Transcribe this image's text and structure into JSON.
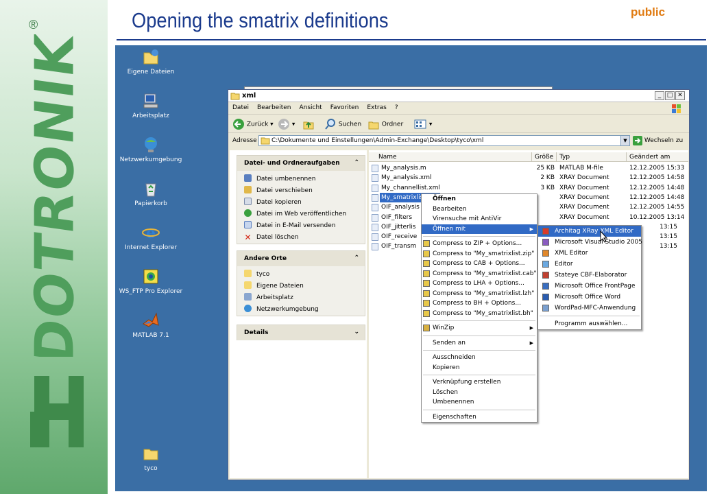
{
  "slide": {
    "title": "Opening the smatrix definitions",
    "classification": "public",
    "brand": "EDOTRONIK",
    "brand_reg": "®"
  },
  "desktop": {
    "icons": [
      {
        "label": "Eigene Dateien",
        "icon": "my-documents-icon"
      },
      {
        "label": "Arbeitsplatz",
        "icon": "my-computer-icon"
      },
      {
        "label": "Netzwerkumgebung",
        "icon": "network-icon"
      },
      {
        "label": "Papierkorb",
        "icon": "recycle-bin-icon"
      },
      {
        "label": "Internet Explorer",
        "icon": "internet-explorer-icon"
      },
      {
        "label": "WS_FTP Pro Explorer",
        "icon": "ftp-icon"
      },
      {
        "label": "MATLAB 7.1",
        "icon": "matlab-icon"
      },
      {
        "label": "tyco",
        "icon": "folder-icon"
      }
    ]
  },
  "window": {
    "title": "xml",
    "menu": [
      "Datei",
      "Bearbeiten",
      "Ansicht",
      "Favoriten",
      "Extras",
      "?"
    ],
    "toolbar": {
      "back": "Zurück",
      "search": "Suchen",
      "folders": "Ordner"
    },
    "address_label": "Adresse",
    "address": "C:\\Dokumente und Einstellungen\\Admin-Exchange\\Desktop\\tyco\\xml",
    "go_label": "Wechseln zu"
  },
  "taskpane": {
    "file_tasks": {
      "title": "Datei- und Ordneraufgaben",
      "items": [
        "Datei umbenennen",
        "Datei verschieben",
        "Datei kopieren",
        "Datei im Web veröffentlichen",
        "Datei in E-Mail versenden",
        "Datei löschen"
      ]
    },
    "other_places": {
      "title": "Andere Orte",
      "items": [
        "tyco",
        "Eigene Dateien",
        "Arbeitsplatz",
        "Netzwerkumgebung"
      ]
    },
    "details": {
      "title": "Details"
    }
  },
  "filelist": {
    "columns": [
      "Name",
      "Größe",
      "Typ",
      "Geändert am"
    ],
    "rows": [
      {
        "name": "My_analysis.m",
        "size": "25 KB",
        "type": "MATLAB M-file",
        "date": "12.12.2005 15:33"
      },
      {
        "name": "My_analysis.xml",
        "size": "2 KB",
        "type": "XRAY Document",
        "date": "12.12.2005 14:58"
      },
      {
        "name": "My_channellist.xml",
        "size": "3 KB",
        "type": "XRAY Document",
        "date": "12.12.2005 14:48"
      },
      {
        "name": "My_smatrixlist.xml",
        "size": "",
        "type": "XRAY Document",
        "date": "12.12.2005 14:48"
      },
      {
        "name": "OIF_analysis",
        "size": "",
        "type": "XRAY Document",
        "date": "12.12.2005 14:55"
      },
      {
        "name": "OIF_filters",
        "size": "",
        "type": "XRAY Document",
        "date": "10.12.2005 13:14"
      },
      {
        "name": "OIF_jitterlis",
        "size": "",
        "type": "",
        "date": "13:15"
      },
      {
        "name": "OIF_receive",
        "size": "",
        "type": "",
        "date": "13:15"
      },
      {
        "name": "OIF_transm",
        "size": "",
        "type": "",
        "date": "13:15"
      }
    ]
  },
  "context_menu": {
    "items": [
      {
        "label": "Öffnen",
        "bold": true
      },
      {
        "label": "Bearbeiten"
      },
      {
        "label": "Virensuche mit AntiVir"
      },
      {
        "label": "Öffnen mit",
        "submenu": true,
        "highlight": true
      },
      {
        "sep": true
      },
      {
        "label": "Compress to ZIP + Options...",
        "icon": "compress-icon"
      },
      {
        "label": "Compress to \"My_smatrixlist.zip\"",
        "icon": "compress-icon"
      },
      {
        "label": "Compress to CAB + Options...",
        "icon": "compress-icon"
      },
      {
        "label": "Compress to \"My_smatrixlist.cab\"",
        "icon": "compress-icon"
      },
      {
        "label": "Compress to LHA + Options...",
        "icon": "compress-icon"
      },
      {
        "label": "Compress to \"My_smatrixlist.lzh\"",
        "icon": "compress-icon"
      },
      {
        "label": "Compress to BH + Options...",
        "icon": "compress-icon"
      },
      {
        "label": "Compress to \"My_smatrixlist.bh\"",
        "icon": "compress-icon"
      },
      {
        "sep": true
      },
      {
        "label": "WinZip",
        "submenu": true,
        "icon": "winzip-icon"
      },
      {
        "sep": true
      },
      {
        "label": "Senden an",
        "submenu": true
      },
      {
        "sep": true
      },
      {
        "label": "Ausschneiden"
      },
      {
        "label": "Kopieren"
      },
      {
        "sep": true
      },
      {
        "label": "Verknüpfung erstellen"
      },
      {
        "label": "Löschen"
      },
      {
        "label": "Umbenennen"
      },
      {
        "sep": true
      },
      {
        "label": "Eigenschaften"
      }
    ]
  },
  "open_with_menu": {
    "items": [
      {
        "label": "Architag XRay XML Editor",
        "icon": "xray-icon",
        "highlight": true
      },
      {
        "label": "Microsoft Visual Studio 2005",
        "icon": "visual-studio-icon"
      },
      {
        "label": "XML Editor",
        "icon": "xml-editor-icon"
      },
      {
        "label": "Editor",
        "icon": "notepad-icon"
      },
      {
        "label": "Stateye CBF-Elaborator",
        "icon": "stateye-icon"
      },
      {
        "label": "Microsoft Office FrontPage",
        "icon": "frontpage-icon"
      },
      {
        "label": "Microsoft Office Word",
        "icon": "word-icon"
      },
      {
        "label": "WordPad-MFC-Anwendung",
        "icon": "wordpad-icon"
      },
      {
        "sep": true
      },
      {
        "label": "Programm auswählen..."
      }
    ]
  }
}
